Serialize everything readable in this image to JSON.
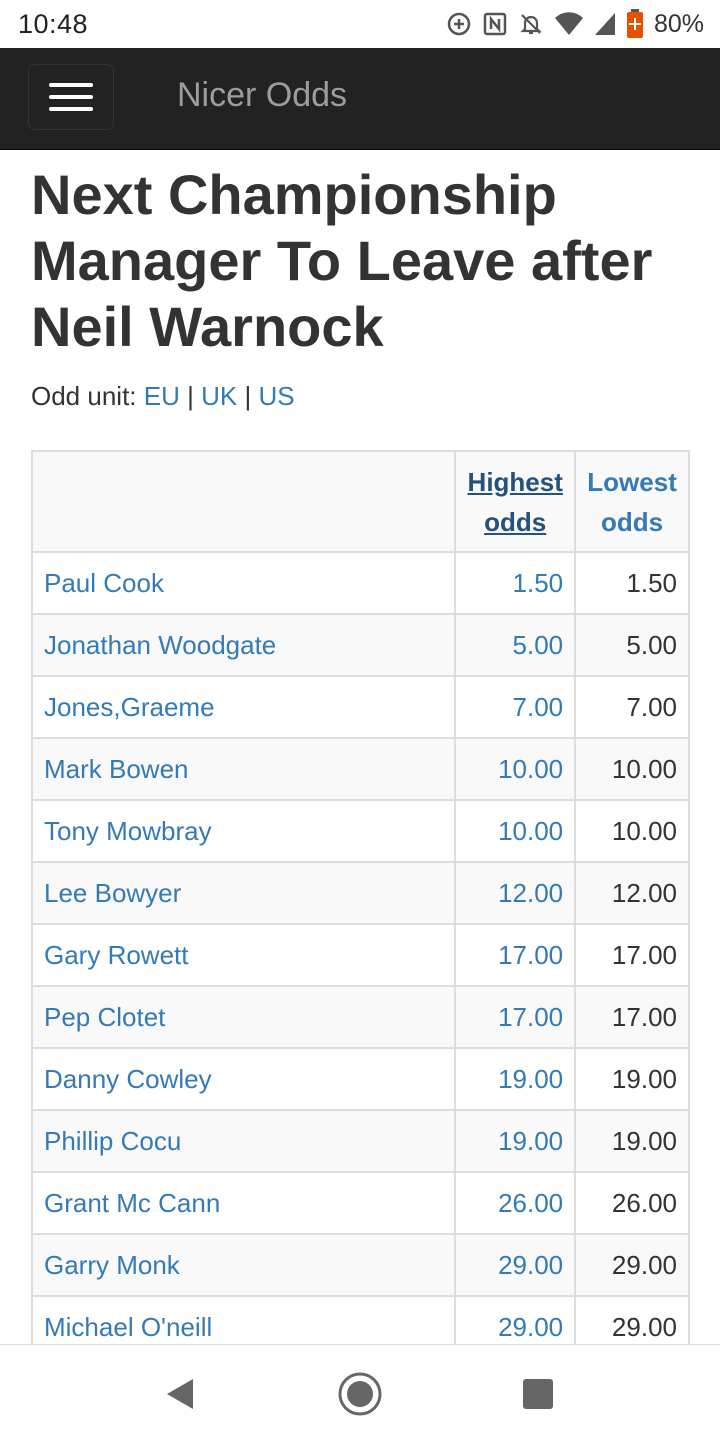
{
  "status": {
    "time": "10:48",
    "battery_pct": "80%",
    "icons": [
      "add-circle-icon",
      "nfc-icon",
      "notifications-off-icon",
      "wifi-icon",
      "signal-icon",
      "battery-saver-icon"
    ]
  },
  "navbar": {
    "brand": "Nicer Odds",
    "menu_icon": "hamburger-menu-icon"
  },
  "page": {
    "title": "Next Championship Manager To Leave after Neil Warnock",
    "odd_unit_label": "Odd unit:",
    "odd_units": [
      "EU",
      "UK",
      "US"
    ],
    "separator": "|"
  },
  "table": {
    "headers": {
      "name": "",
      "highest_line1": "Highest",
      "highest_line2": "odds",
      "lowest_line1": "Lowest",
      "lowest_line2": "odds"
    },
    "rows": [
      {
        "name": "Paul Cook",
        "highest": "1.50",
        "lowest": "1.50"
      },
      {
        "name": "Jonathan Woodgate",
        "highest": "5.00",
        "lowest": "5.00"
      },
      {
        "name": "Jones,Graeme",
        "highest": "7.00",
        "lowest": "7.00"
      },
      {
        "name": "Mark Bowen",
        "highest": "10.00",
        "lowest": "10.00"
      },
      {
        "name": "Tony Mowbray",
        "highest": "10.00",
        "lowest": "10.00"
      },
      {
        "name": "Lee Bowyer",
        "highest": "12.00",
        "lowest": "12.00"
      },
      {
        "name": "Gary Rowett",
        "highest": "17.00",
        "lowest": "17.00"
      },
      {
        "name": "Pep Clotet",
        "highest": "17.00",
        "lowest": "17.00"
      },
      {
        "name": "Danny Cowley",
        "highest": "19.00",
        "lowest": "19.00"
      },
      {
        "name": "Phillip Cocu",
        "highest": "19.00",
        "lowest": "19.00"
      },
      {
        "name": "Grant Mc Cann",
        "highest": "26.00",
        "lowest": "26.00"
      },
      {
        "name": "Garry Monk",
        "highest": "29.00",
        "lowest": "29.00"
      },
      {
        "name": "Michael O'neill",
        "highest": "29.00",
        "lowest": "29.00"
      }
    ]
  },
  "android_nav": {
    "buttons": [
      "back-icon",
      "home-icon",
      "recents-icon"
    ]
  },
  "colors": {
    "link": "#337ab7",
    "navbar_bg": "#222222",
    "brand_text": "#9d9d9d",
    "battery_accent": "#e65100"
  }
}
